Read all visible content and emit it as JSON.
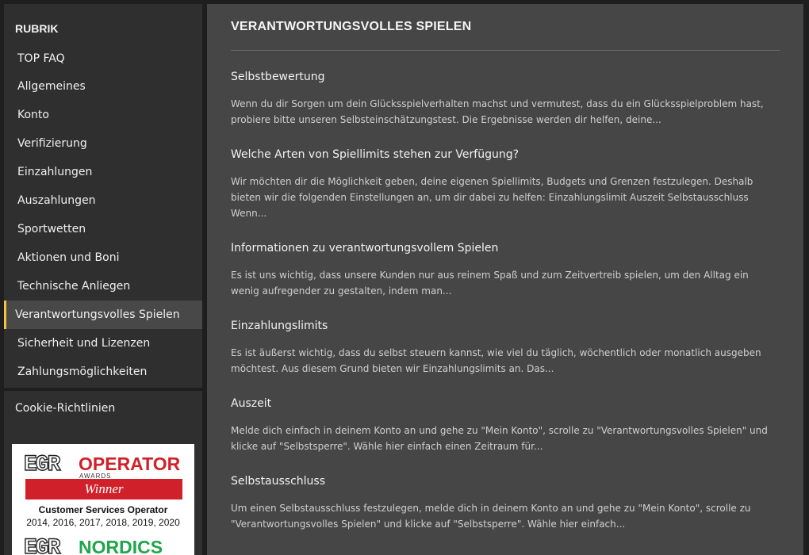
{
  "sidebar": {
    "heading": "RUBRIK",
    "items": [
      {
        "label": "TOP FAQ"
      },
      {
        "label": "Allgemeines"
      },
      {
        "label": "Konto"
      },
      {
        "label": "Verifizierung"
      },
      {
        "label": "Einzahlungen"
      },
      {
        "label": "Auszahlungen"
      },
      {
        "label": "Sportwetten"
      },
      {
        "label": "Aktionen und Boni"
      },
      {
        "label": "Technische Anliegen"
      },
      {
        "label": "Verantwortungsvolles Spielen"
      },
      {
        "label": "Sicherheit und Lizenzen"
      },
      {
        "label": "Zahlungsmöglichkeiten"
      }
    ],
    "active_index": 9,
    "active_color": "#f5c33b",
    "cookie_link": "Cookie-Richtlinien"
  },
  "award": {
    "logo_text": "EGR",
    "brand": "OPERATOR",
    "awards_word": "AWARDS",
    "winner": "Winner",
    "category": "Customer Services Operator",
    "years": "2014, 2016, 2017, 2018, 2019, 2020",
    "logo2_text": "EGR",
    "brand2": "NORDICS",
    "brand_color": "#d0212b",
    "brand2_color": "#1fa64a"
  },
  "main": {
    "title": "VERANTWORTUNGSVOLLES SPIELEN",
    "articles": [
      {
        "title": "Selbstbewertung",
        "excerpt": "Wenn du dir Sorgen um dein Glücksspielverhalten machst und vermutest, dass du ein Glücksspielproblem hast, probiere bitte unseren Selbsteinschätzungstest. Die Ergebnisse werden dir helfen, deine..."
      },
      {
        "title": "Welche Arten von Spiellimits stehen zur Verfügung?",
        "excerpt": "Wir möchten dir die Möglichkeit geben, deine eigenen Spiellimits, Budgets und Grenzen festzulegen. Deshalb bieten wir die folgenden Einstellungen an, um dir dabei zu helfen: Einzahlungslimit Auszeit Selbstausschluss Wenn..."
      },
      {
        "title": "Informationen zu verantwortungsvollem Spielen",
        "excerpt": "Es ist uns wichtig, dass unsere Kunden nur aus reinem Spaß und zum Zeitvertreib spielen, um den Alltag ein wenig aufregender zu gestalten, indem man..."
      },
      {
        "title": "Einzahlungslimits",
        "excerpt": "Es ist äußerst wichtig, dass du selbst steuern kannst, wie viel du täglich, wöchentlich oder monatlich ausgeben möchtest. Aus diesem Grund bieten wir Einzahlungslimits an. Das..."
      },
      {
        "title": "Auszeit",
        "excerpt": "Melde dich einfach in deinem Konto an und gehe zu \"Mein Konto\", scrolle zu \"Verantwortungsvolles Spielen\" und klicke auf \"Selbstsperre\". Wähle hier einfach einen Zeitraum für..."
      },
      {
        "title": "Selbstausschluss",
        "excerpt": "Um einen Selbstausschluss festzulegen, melde dich in deinem Konto an und gehe zu \"Mein Konto\", scrolle zu \"Verantwortungsvolles Spielen\" und klicke auf \"Selbstsperre\". Wähle hier einfach..."
      }
    ]
  }
}
